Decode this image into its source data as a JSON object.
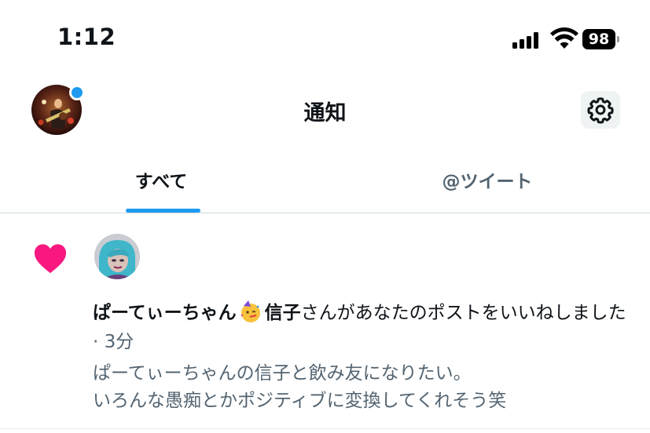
{
  "status_bar": {
    "time": "1:12",
    "battery": "98"
  },
  "header": {
    "title": "通知",
    "avatar_icon": "profile-avatar-icon",
    "settings_icon": "gear-icon"
  },
  "tabs": [
    {
      "label": "すべて",
      "selected": true
    },
    {
      "label": "@ツイート",
      "selected": false
    }
  ],
  "notification": {
    "icon": "heart-icon",
    "user_name": "ぱーてぃーちゃん",
    "user_name_2": "信子",
    "action_text": "さんがあなたのポストをいいねしました",
    "separator": " · ",
    "time": "3分",
    "post_lines": [
      "ぱーてぃーちゃんの信子と飲み友になりたい。",
      "いろんな愚痴とかポジティブに変換してくれそう笑"
    ]
  },
  "colors": {
    "accent": "#1d9bf0",
    "like": "#f91880",
    "secondary_text": "#536471"
  }
}
